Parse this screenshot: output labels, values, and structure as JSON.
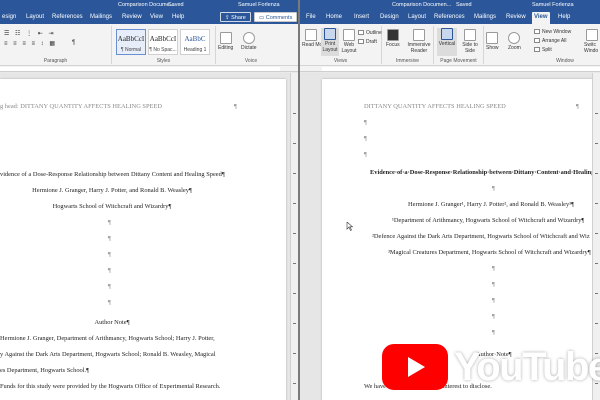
{
  "left": {
    "window_title": "Comparison Docume...",
    "saved_label": "Saved",
    "user": "Samuel Forlenza",
    "tabs": [
      "esign",
      "Layout",
      "References",
      "Mailings",
      "Review",
      "View",
      "Help"
    ],
    "share_label": "Share",
    "comments_label": "Comments",
    "styles": [
      {
        "sample": "AaBbCcI",
        "name": "¶ Normal"
      },
      {
        "sample": "AaBbCcI",
        "name": "¶ No Spac..."
      },
      {
        "sample": "AaBbC",
        "name": "Heading 1"
      }
    ],
    "editing_label": "Editing",
    "dictate_label": "Dictate",
    "group_labels": [
      "Paragraph",
      "Styles",
      "Voice"
    ],
    "doc": {
      "running_head": "g head: DITTANY QUANTITY AFFECTS HEALING SPEED",
      "page_num_mark": "¶",
      "title": "vidence of a Dose-Response Relationship between Dittany Content and Healing Speed¶",
      "authors": "Hermione J. Granger, Harry J. Potter, and Ronald B. Weasley¶",
      "affiliation": "Hogwarts School of Witchcraft and Wizardry¶",
      "pilcrow": "¶",
      "author_note_heading": "Author Note¶",
      "note_lines": [
        "Hermione J. Granger, Department of Arithmancy, Hogwarts School; Harry J. Potter,",
        "y Against the Dark Arts Department, Hogwarts School; Ronald B. Weasley, Magical",
        "es Department, Hogwarts School.¶",
        "Funds for this study were provided by the Hogwarts Office of Experimental Research."
      ]
    }
  },
  "right": {
    "window_title": "Comparison Documen...",
    "saved_label": "Saved",
    "user": "Samuel Forlenza",
    "tabs": [
      "File",
      "Home",
      "Insert",
      "Design",
      "Layout",
      "References",
      "Mailings",
      "Review",
      "View",
      "Help"
    ],
    "active_tab": "View",
    "views": [
      "Read Mode",
      "Print Layout",
      "Web Layout"
    ],
    "outline_label": "Outline",
    "draft_label": "Draft",
    "immersive": [
      "Focus",
      "Immersive Reader"
    ],
    "page_movement": [
      "Vertical",
      "Side to Side"
    ],
    "show_label": "Show",
    "zoom_label": "Zoom",
    "window_items": [
      "New Window",
      "Arrange All",
      "Split"
    ],
    "switch_label": "Switc Windo",
    "group_labels": [
      "Views",
      "Immersive",
      "Page Movement",
      "Window"
    ],
    "doc": {
      "running_head": "DITTANY QUANTITY AFFECTS HEALING SPEED",
      "page_num_mark": "¶",
      "pilcrow": "¶",
      "title": "Evidence·of·a·Dose-Response·Relationship·between·Dittany·Content·and·Healing·",
      "authors": "Hermione J. Granger¹, Harry J. Potter², and Ronald B. Weasley³¶",
      "affil1": "¹Department of Arithmancy, Hogwarts School of Witchcraft and Wizardry¶",
      "affil2": "²Defence Against the Dark Arts Department, Hogwarts School of Witchcraft and Wiz",
      "affil3": "³Magical Creatures Department, Hogwarts School of Witchcraft and Wizardry¶",
      "author_note_heading": "Author·Note¶",
      "note_start": "We have no known conflict of interest to disclose."
    }
  },
  "overlay": {
    "brand_text": "YouTube",
    "brand_color": "#ff0000"
  },
  "colors": {
    "word_blue": "#2b579a"
  }
}
